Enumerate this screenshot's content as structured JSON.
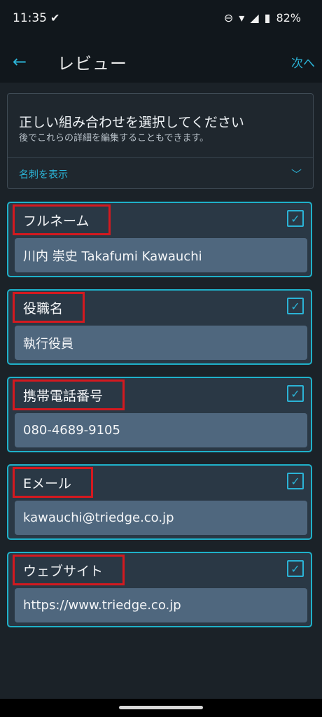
{
  "status": {
    "time": "11:35",
    "battery": "82%"
  },
  "appbar": {
    "title": "レビュー",
    "next": "次へ"
  },
  "info": {
    "title": "正しい組み合わせを選択してください",
    "subtitle": "後でこれらの詳細を編集することもできます。",
    "link": "名刺を表示"
  },
  "fields": [
    {
      "label": "フルネーム",
      "value": "川内 崇史 Takafumi Kawauchi",
      "checked": true
    },
    {
      "label": "役職名",
      "value": "執行役員",
      "checked": true
    },
    {
      "label": "携帯電話番号",
      "value": "080-4689-9105",
      "checked": true
    },
    {
      "label": "Eメール",
      "value": "kawauchi@triedge.co.jp",
      "checked": true
    },
    {
      "label": "ウェブサイト",
      "value": "https://www.triedge.co.jp",
      "checked": true
    }
  ]
}
